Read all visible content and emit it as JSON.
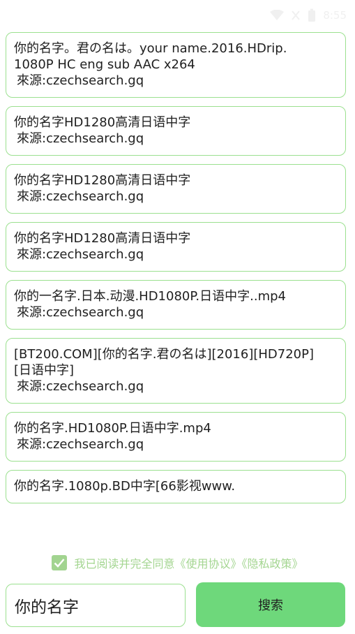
{
  "status_bar": {
    "time": "8:55"
  },
  "results": [
    {
      "title": "你的名字。君の名は。your name.2016.HDrip.\n1080P HC eng sub AAC x264",
      "source": "來源:czechsearch.gq"
    },
    {
      "title": "你的名字HD1280高清日语中字",
      "source": "來源:czechsearch.gq"
    },
    {
      "title": "你的名字HD1280高清日语中字",
      "source": "來源:czechsearch.gq"
    },
    {
      "title": "你的名字HD1280高清日语中字",
      "source": "來源:czechsearch.gq"
    },
    {
      "title": "你的一名字.日本.动漫.HD1080P.日语中字..mp4",
      "source": "來源:czechsearch.gq"
    },
    {
      "title": "[BT200.COM][你的名字.君の名は][2016][HD720P]\n[日语中字]",
      "source": "來源:czechsearch.gq"
    },
    {
      "title": "你的名字.HD1080P.日语中字.mp4",
      "source": "來源:czechsearch.gq"
    },
    {
      "title": "你的名字.1080p.BD中字[66影视www.",
      "source": ""
    }
  ],
  "agreement": {
    "checked": true,
    "text": "我已阅读并完全同意《使用协议》《隐私政策》"
  },
  "search": {
    "value": "你的名字",
    "button_label": "搜索"
  },
  "colors": {
    "accent_border": "#9be08f",
    "button_green": "#6ed87b",
    "agree_text": "#a4d691"
  }
}
